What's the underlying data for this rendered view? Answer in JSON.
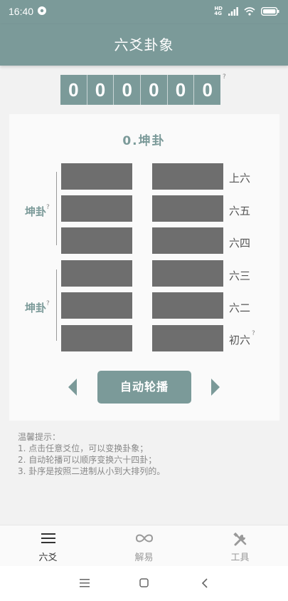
{
  "status": {
    "time": "16:40",
    "network_top": "HD",
    "network_bottom": "4G"
  },
  "app": {
    "title": "六爻卦象"
  },
  "numbers": {
    "digits": [
      "0",
      "0",
      "0",
      "0",
      "0",
      "0"
    ],
    "help": "?"
  },
  "hexagram": {
    "title": "0.坤卦",
    "upper_trigram": "坤卦",
    "lower_trigram": "坤卦",
    "trigram_help": "?",
    "lines": [
      {
        "label": "上六",
        "type": "yin"
      },
      {
        "label": "六五",
        "type": "yin"
      },
      {
        "label": "六四",
        "type": "yin"
      },
      {
        "label": "六三",
        "type": "yin"
      },
      {
        "label": "六二",
        "type": "yin"
      },
      {
        "label": "初六",
        "type": "yin"
      }
    ],
    "bottom_line_help": "?"
  },
  "controls": {
    "autoplay_label": "自动轮播"
  },
  "tips": {
    "heading": "温馨提示：",
    "items": [
      "1. 点击任意爻位，可以变换卦象；",
      "2. 自动轮播可以顺序变换六十四卦；",
      "3. 卦序是按照二进制从小到大排列的。"
    ]
  },
  "bottom_nav": [
    {
      "label": "六爻",
      "icon": "menu-icon",
      "active": true
    },
    {
      "label": "解易",
      "icon": "infinity-icon",
      "active": false
    },
    {
      "label": "工具",
      "icon": "tools-icon",
      "active": false
    }
  ],
  "colors": {
    "accent": "#7b9a99",
    "line": "#6e6e6e",
    "background": "#f2f2f2"
  }
}
